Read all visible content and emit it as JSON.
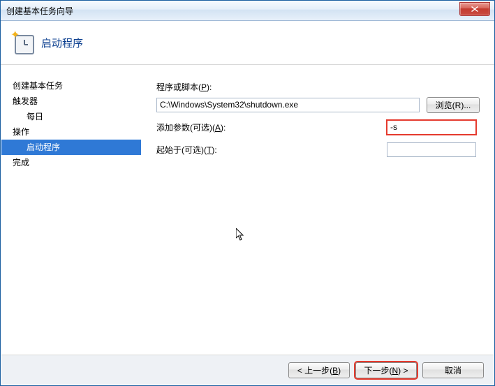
{
  "window": {
    "title": "创建基本任务向导"
  },
  "header": {
    "title": "启动程序"
  },
  "sidebar": {
    "items": [
      {
        "label": "创建基本任务",
        "sub": false,
        "selected": false
      },
      {
        "label": "触发器",
        "sub": false,
        "selected": false
      },
      {
        "label": "每日",
        "sub": true,
        "selected": false
      },
      {
        "label": "操作",
        "sub": false,
        "selected": false
      },
      {
        "label": "启动程序",
        "sub": true,
        "selected": true
      },
      {
        "label": "完成",
        "sub": false,
        "selected": false
      }
    ]
  },
  "form": {
    "program_label_pre": "程序或脚本(",
    "program_label_key": "P",
    "program_label_post": "):",
    "program_value": "C:\\Windows\\System32\\shutdown.exe",
    "browse_pre": "浏览(",
    "browse_key": "R",
    "browse_post": ")...",
    "args_label_pre": "添加参数(可选)(",
    "args_label_key": "A",
    "args_label_post": "):",
    "args_value": "-s",
    "startin_label_pre": "起始于(可选)(",
    "startin_label_key": "T",
    "startin_label_post": "):",
    "startin_value": ""
  },
  "footer": {
    "back_pre": "< 上一步(",
    "back_key": "B",
    "back_post": ")",
    "next_pre": "下一步(",
    "next_key": "N",
    "next_post": ") >",
    "cancel": "取消"
  }
}
